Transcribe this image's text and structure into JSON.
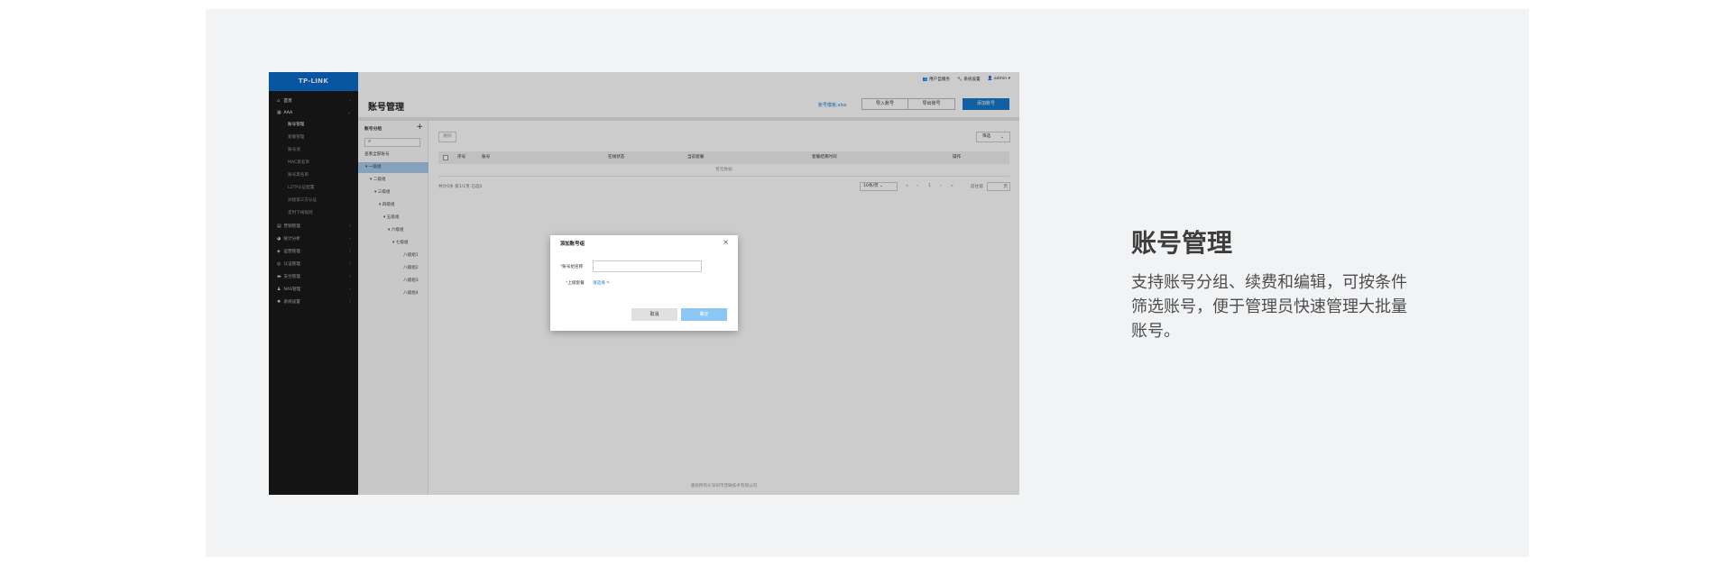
{
  "feature": {
    "title": "账号管理",
    "description": "支持账号分组、续费和编辑，可按条件筛选账号，便于管理员快速管理大批量账号。"
  },
  "app": {
    "logo": "TP-LINK",
    "topbar": {
      "user_service": "用户自服务",
      "system_settings": "系统设置",
      "admin": "admin ▾"
    },
    "sidebar": {
      "items": [
        {
          "icon": "home-icon",
          "label": "首页"
        },
        {
          "icon": "grid-icon",
          "label": "AAA"
        },
        {
          "label": "账号管理"
        },
        {
          "label": "套餐管理"
        },
        {
          "label": "账号池"
        },
        {
          "label": "MAC黑名单"
        },
        {
          "label": "账号黑名单"
        },
        {
          "label": "L2TP认证配置"
        },
        {
          "label": "对接第三方认证"
        },
        {
          "label": "定时下线规则"
        },
        {
          "icon": "document-icon",
          "label": "营销管理"
        },
        {
          "icon": "chart-icon",
          "label": "统计分析"
        },
        {
          "icon": "shield-icon",
          "label": "运营管理"
        },
        {
          "icon": "lock-icon",
          "label": "认证管理"
        },
        {
          "icon": "card-icon",
          "label": "支付管理"
        },
        {
          "icon": "user-icon",
          "label": "NAS管理"
        },
        {
          "icon": "gear-icon",
          "label": "系统设置"
        }
      ]
    },
    "page": {
      "title": "账号管理",
      "template_link": "账号模板.xlsx",
      "import_btn": "导入账号",
      "export_btn": "导出账号",
      "add_btn": "添加账号"
    },
    "tree": {
      "header": "账号分组",
      "add": "+",
      "nodes": [
        {
          "label": "查看全部账号"
        },
        {
          "label": "▾ 一级组"
        },
        {
          "label": "▾ 二级组"
        },
        {
          "label": "▾ 三级组"
        },
        {
          "label": "▾ 四级组"
        },
        {
          "label": "▾ 五级组"
        },
        {
          "label": "▾ 六级组"
        },
        {
          "label": "▾ 七级组"
        },
        {
          "label": "八级组1"
        },
        {
          "label": "八级组2"
        },
        {
          "label": "八级组3"
        },
        {
          "label": "八级组4"
        }
      ]
    },
    "table": {
      "delete_btn": "删除",
      "filter": "筛选",
      "columns": [
        "序号",
        "账号",
        "在线状态",
        "当前套餐",
        "套餐结束时间",
        "操作"
      ],
      "empty": "暂无数据",
      "total": "共计0条 第1/1页 已选0",
      "page_size": "10条/页",
      "pages": [
        "«",
        "‹",
        "1",
        "›",
        "»"
      ],
      "goto": "前往第",
      "page_unit": "页"
    },
    "footer": "版权所有©深圳市普联技术有限公司",
    "modal": {
      "title": "添加账号组",
      "close": "×",
      "name_label": "账号组名称",
      "parent_label": "上级套餐",
      "parent_link": "请选择",
      "cancel": "取消",
      "ok": "确定"
    }
  }
}
